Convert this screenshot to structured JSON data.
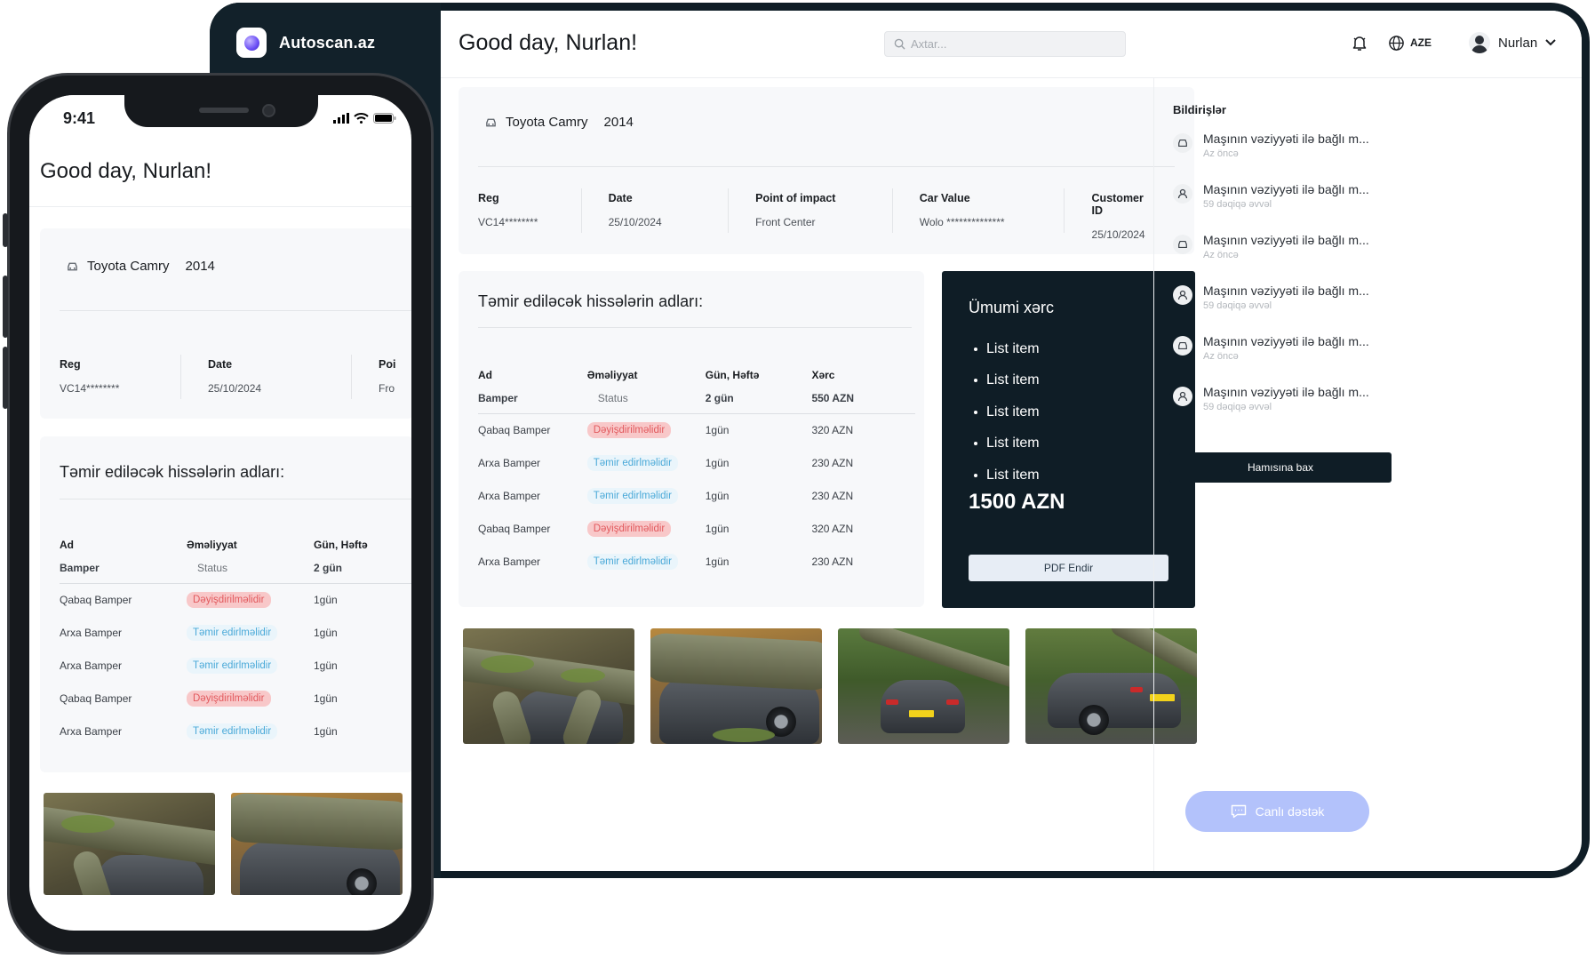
{
  "app": {
    "brand_name": "Autoscan.az",
    "greeting": "Good day, Nurlan!",
    "search_placeholder": "Axtar...",
    "language": "AZE",
    "user_name": "Nurlan"
  },
  "vehicle": {
    "model": "Toyota Camry",
    "year": "2014",
    "fields": [
      {
        "label": "Reg",
        "value": "VC14********"
      },
      {
        "label": "Date",
        "value": "25/10/2024"
      },
      {
        "label": "Point of impact",
        "value": "Front Center"
      },
      {
        "label": "Car Value",
        "value": "Wolo **************"
      },
      {
        "label": "Customer ID",
        "value": "25/10/2024"
      }
    ],
    "mobile_cut_label": "Poi",
    "mobile_cut_value": "Fro"
  },
  "parts": {
    "title": "Təmir ediləcək hissələrin adları:",
    "headers": [
      "Ad",
      "Əməliyyat",
      "Gün, Həftə",
      "Xərc"
    ],
    "summary": {
      "name": "Bamper",
      "status": "Status",
      "duration": "2 gün",
      "cost": "550 AZN"
    },
    "rows": [
      {
        "name": "Qabaq Bamper",
        "status": "Dəyişdirilməlidir",
        "duration": "1gün",
        "cost": "320 AZN"
      },
      {
        "name": "Arxa Bamper",
        "status": "Təmir edirlməlidir",
        "duration": "1gün",
        "cost": "230 AZN"
      },
      {
        "name": "Arxa Bamper",
        "status": "Təmir edirlməlidir",
        "duration": "1gün",
        "cost": "230 AZN"
      },
      {
        "name": "Qabaq Bamper",
        "status": "Dəyişdirilməlidir",
        "duration": "1gün",
        "cost": "320 AZN"
      },
      {
        "name": "Arxa Bamper",
        "status": "Təmir edirlməlidir",
        "duration": "1gün",
        "cost": "230 AZN"
      }
    ]
  },
  "total": {
    "title": "Ümumi xərc",
    "items": [
      "List item",
      "List item",
      "List item",
      "List item",
      "List item"
    ],
    "amount": "1500 AZN",
    "pdf_label": "PDF Endir"
  },
  "notifications": {
    "title": "Bildirişlər",
    "items": [
      {
        "icon": "car-icon",
        "text": "Maşının vəziyyəti ilə bağlı m...",
        "time": "Az öncə"
      },
      {
        "icon": "user-icon",
        "text": "Maşının vəziyyəti ilə bağlı m...",
        "time": "59 dəqiqə əvvəl"
      },
      {
        "icon": "car-icon",
        "text": "Maşının vəziyyəti ilə bağlı m...",
        "time": "Az öncə"
      },
      {
        "icon": "user-icon",
        "text": "Maşının vəziyyəti ilə bağlı m...",
        "time": "59 dəqiqə əvvəl"
      },
      {
        "icon": "car-icon",
        "text": "Maşının vəziyyəti ilə bağlı m...",
        "time": "Az öncə"
      },
      {
        "icon": "user-icon",
        "text": "Maşının vəziyyəti ilə bağlı m...",
        "time": "59 dəqiqə əvvəl"
      }
    ],
    "see_all_label": "Hamısına bax"
  },
  "support": {
    "label": "Canlı dəstək"
  },
  "mobile": {
    "time": "9:41"
  },
  "colors": {
    "dark": "#0f1d26",
    "badge_red_bg": "#f8c8c9",
    "badge_red_text": "#e25a5e",
    "badge_blue_bg": "#eaf5fb",
    "badge_blue_text": "#4aa9d8",
    "support_button": "#b3c2fb"
  }
}
